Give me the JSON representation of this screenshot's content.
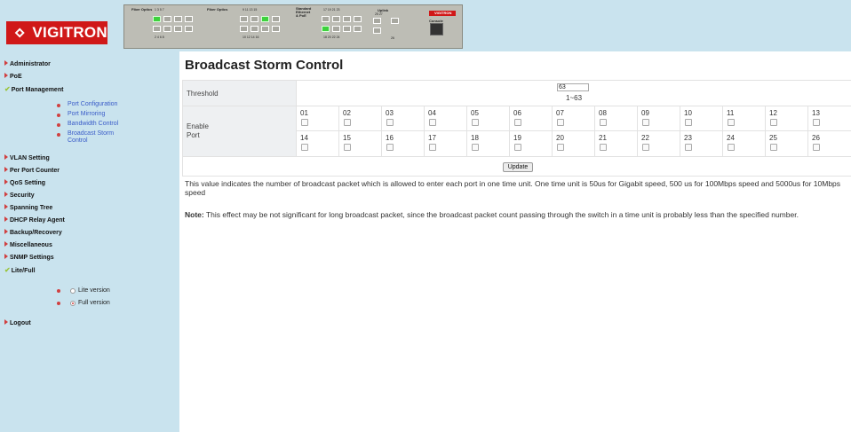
{
  "header": {
    "brand": "VIGITRON",
    "panel": {
      "label_fiber1": "Fiber Optics",
      "label_fiber2": "Fiber Optics",
      "label_standard": "Standard Ethernet & PoE",
      "label_uplink": "Uplink",
      "label_console": "Console",
      "panel_brand": "VIGITRON",
      "top_nums_1": "1  3  5  7",
      "bot_nums_1": "2  4  6  8",
      "top_nums_2": "9  11  13  15",
      "bot_nums_2": "10  12  14  16",
      "top_nums_3": "17  19  21  23",
      "bot_nums_3": "18  20  22  24",
      "uplink_top": "25  27",
      "uplink_bot": "26"
    }
  },
  "sidebar": {
    "items": [
      {
        "label": "Administrator"
      },
      {
        "label": "PoE"
      },
      {
        "label": "Port Management"
      },
      {
        "label": "VLAN Setting"
      },
      {
        "label": "Per Port Counter"
      },
      {
        "label": "QoS Setting"
      },
      {
        "label": "Security"
      },
      {
        "label": "Spanning Tree"
      },
      {
        "label": "DHCP Relay Agent"
      },
      {
        "label": "Backup/Recovery"
      },
      {
        "label": "Miscellaneous"
      },
      {
        "label": "SNMP Settings"
      },
      {
        "label": "Lite/Full"
      },
      {
        "label": "Logout"
      }
    ],
    "submenu": [
      {
        "label": "Port Configuration"
      },
      {
        "label": "Port Mirroring"
      },
      {
        "label": "Bandwidth Control"
      },
      {
        "label": "Broadcast Storm Control"
      }
    ],
    "version": {
      "lite": "Lite version",
      "full": "Full version",
      "selected": "full"
    }
  },
  "main": {
    "title": "Broadcast Storm Control",
    "threshold_label": "Threshold",
    "threshold_value": "63",
    "threshold_range": "1~63",
    "enable_port_label": "Enable Port",
    "ports_row1": [
      "01",
      "02",
      "03",
      "04",
      "05",
      "06",
      "07",
      "08",
      "09",
      "10",
      "11",
      "12",
      "13"
    ],
    "ports_row2": [
      "14",
      "15",
      "16",
      "17",
      "18",
      "19",
      "20",
      "21",
      "22",
      "23",
      "24",
      "25",
      "26"
    ],
    "update_label": "Update",
    "description": "This value indicates the number of broadcast packet which is allowed to enter each port in one time unit. One time unit is 50us for Gigabit speed, 500 us for 100Mbps speed and 5000us for 10Mbps speed",
    "note_label": "Note:",
    "note_text": " This effect may be not significant for long broadcast packet, since the broadcast packet count passing through the switch in a time unit is probably less than the specified number."
  },
  "colors": {
    "sidebar_bg": "#c9e3ee",
    "brand_red": "#d01818",
    "link_blue": "#3a5cc8",
    "arrow_red": "#d04040",
    "check_green": "#9ac43a"
  }
}
